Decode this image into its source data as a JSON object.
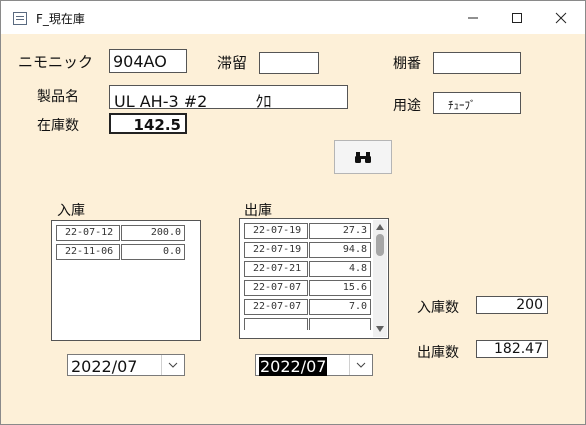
{
  "window": {
    "title": "F_現在庫"
  },
  "form": {
    "mnemonic_label": "ニモニック",
    "mnemonic_value": "904AO",
    "stay_label": "滞留",
    "stay_value": "",
    "shelf_label": "棚番",
    "shelf_value": "",
    "product_label": "製品名",
    "product_value": "UL AH-3 #2　　　ｸﾛ",
    "usage_label": "用途",
    "usage_value": "ﾁｭｰﾌﾞ",
    "stock_label": "在庫数",
    "stock_value": "142.5",
    "find_icon": "binoculars-icon"
  },
  "incoming": {
    "label": "入庫",
    "rows": [
      {
        "date": "22-07-12",
        "qty": "200.0"
      },
      {
        "date": "22-11-06",
        "qty": "0.0"
      }
    ],
    "month_select": "2022/07"
  },
  "outgoing": {
    "label": "出庫",
    "rows": [
      {
        "date": "22-07-19",
        "qty": "27.3"
      },
      {
        "date": "22-07-19",
        "qty": "94.8"
      },
      {
        "date": "22-07-21",
        "qty": "4.8"
      },
      {
        "date": "22-07-07",
        "qty": "15.6"
      },
      {
        "date": "22-07-07",
        "qty": "7.0"
      }
    ],
    "month_select": "2022/07"
  },
  "totals": {
    "in_label": "入庫数",
    "in_value": "200",
    "out_label": "出庫数",
    "out_value": "182.47"
  }
}
